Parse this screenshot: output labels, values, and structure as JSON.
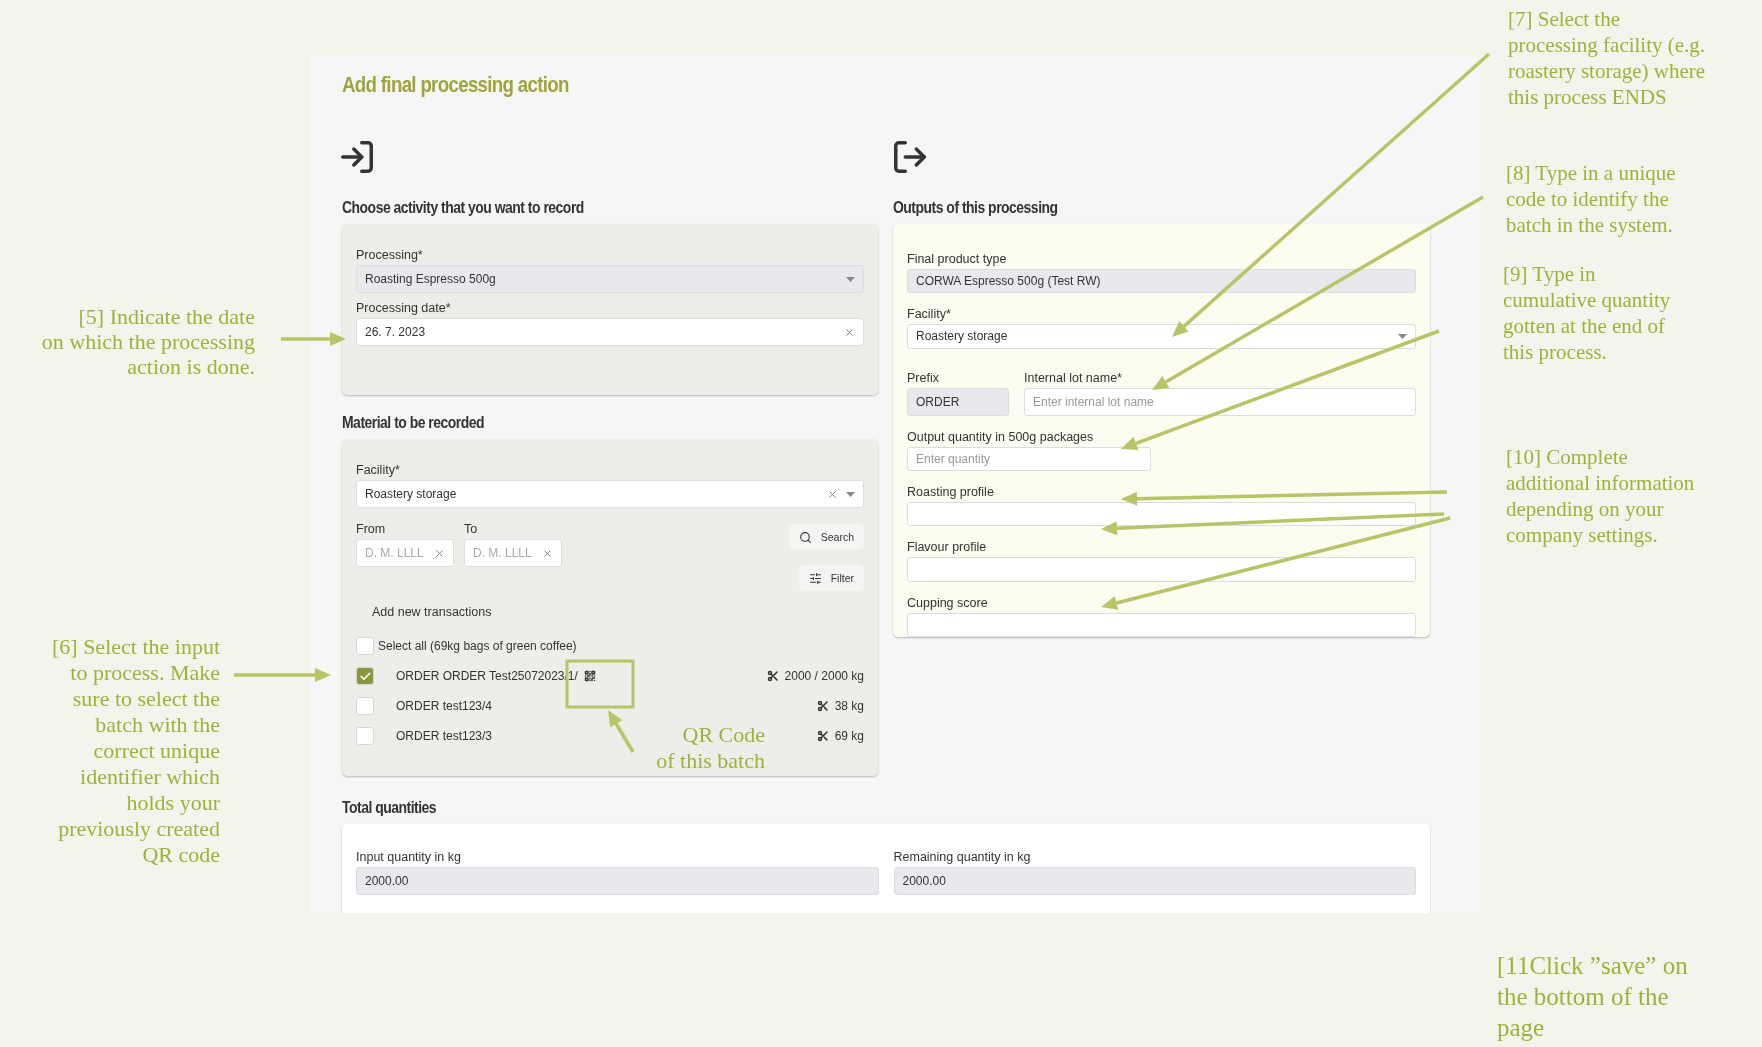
{
  "screen": {
    "title": "Add final processing action",
    "activity": {
      "heading": "Choose activity that you want to record",
      "processing": {
        "label": "Processing*",
        "value": "Roasting Espresso 500g",
        "disabled": true
      },
      "date": {
        "label": "Processing date*",
        "value": "26. 7. 2023",
        "disabled": false
      }
    },
    "material": {
      "heading": "Material to be recorded",
      "facility": {
        "label": "Facility*",
        "value": "Roastery storage",
        "disabled": false
      },
      "from": {
        "label": "From",
        "placeholder": "D. M. LLLL"
      },
      "to": {
        "label": "To",
        "placeholder": "D. M. LLLL"
      },
      "search_button": "Search",
      "filter_button": "Filter",
      "transactions_title": "Add new transactions",
      "select_all": {
        "label": "Select all (69kg bags of green coffee)",
        "checked": false
      },
      "transactions": [
        {
          "name": "ORDER ORDER Test25072023/1/",
          "qr": true,
          "quantity": "2000 / 2000 kg",
          "checked": true
        },
        {
          "name": "ORDER test123/4",
          "qr": false,
          "quantity": "38 kg",
          "checked": false
        },
        {
          "name": "ORDER test123/3",
          "qr": false,
          "quantity": "69 kg",
          "checked": false
        }
      ]
    },
    "outputs": {
      "heading": "Outputs of this processing",
      "product_type": {
        "label": "Final product type",
        "value": "CORWA Espresso 500g (Test RW)",
        "disabled": true
      },
      "facility": {
        "label": "Facility*",
        "value": "Roastery storage",
        "disabled": false
      },
      "prefix": {
        "label": "Prefix",
        "value": "ORDER",
        "disabled": true
      },
      "lot_name": {
        "label": "Internal lot name*",
        "placeholder": "Enter internal lot name"
      },
      "quantity": {
        "label": "Output quantity in 500g packages",
        "placeholder": "Enter quantity"
      },
      "extra_fields": [
        {
          "label": "Roasting profile"
        },
        {
          "label": "Flavour profile"
        },
        {
          "label": "Cupping score"
        }
      ]
    },
    "totals": {
      "heading": "Total quantities",
      "fields": [
        {
          "label": "Input quantity in kg",
          "value": "2000.00"
        },
        {
          "label": "Remaining quantity in kg",
          "value": "2000.00"
        }
      ]
    }
  },
  "callouts": [
    {
      "lines": [
        "[5] Indicate the date",
        "on which the processing",
        "action is done."
      ]
    },
    {
      "lines": [
        "[6] Select the input",
        "to process. Make",
        "sure to select the",
        "batch with the",
        "correct unique",
        "identifier which",
        "holds your",
        "previously created",
        "QR code"
      ]
    },
    {
      "lines": [
        "QR Code",
        "of this batch"
      ]
    },
    {
      "lines": [
        "[7] Select the",
        "processing facility (e.g.",
        "roastery storage) where",
        "this process ENDS"
      ]
    },
    {
      "lines": [
        "[8] Type in a unique",
        "code to identify the",
        "batch in the system."
      ]
    },
    {
      "lines": [
        "[9]  Type in",
        "cumulative quantity",
        "gotten at the end of",
        "this process."
      ]
    },
    {
      "lines": [
        "[10] Complete",
        "additional information",
        "depending on your",
        "company settings."
      ]
    },
    {
      "lines": [
        "[11Click ”save” on",
        "the bottom of the",
        "page"
      ]
    }
  ]
}
